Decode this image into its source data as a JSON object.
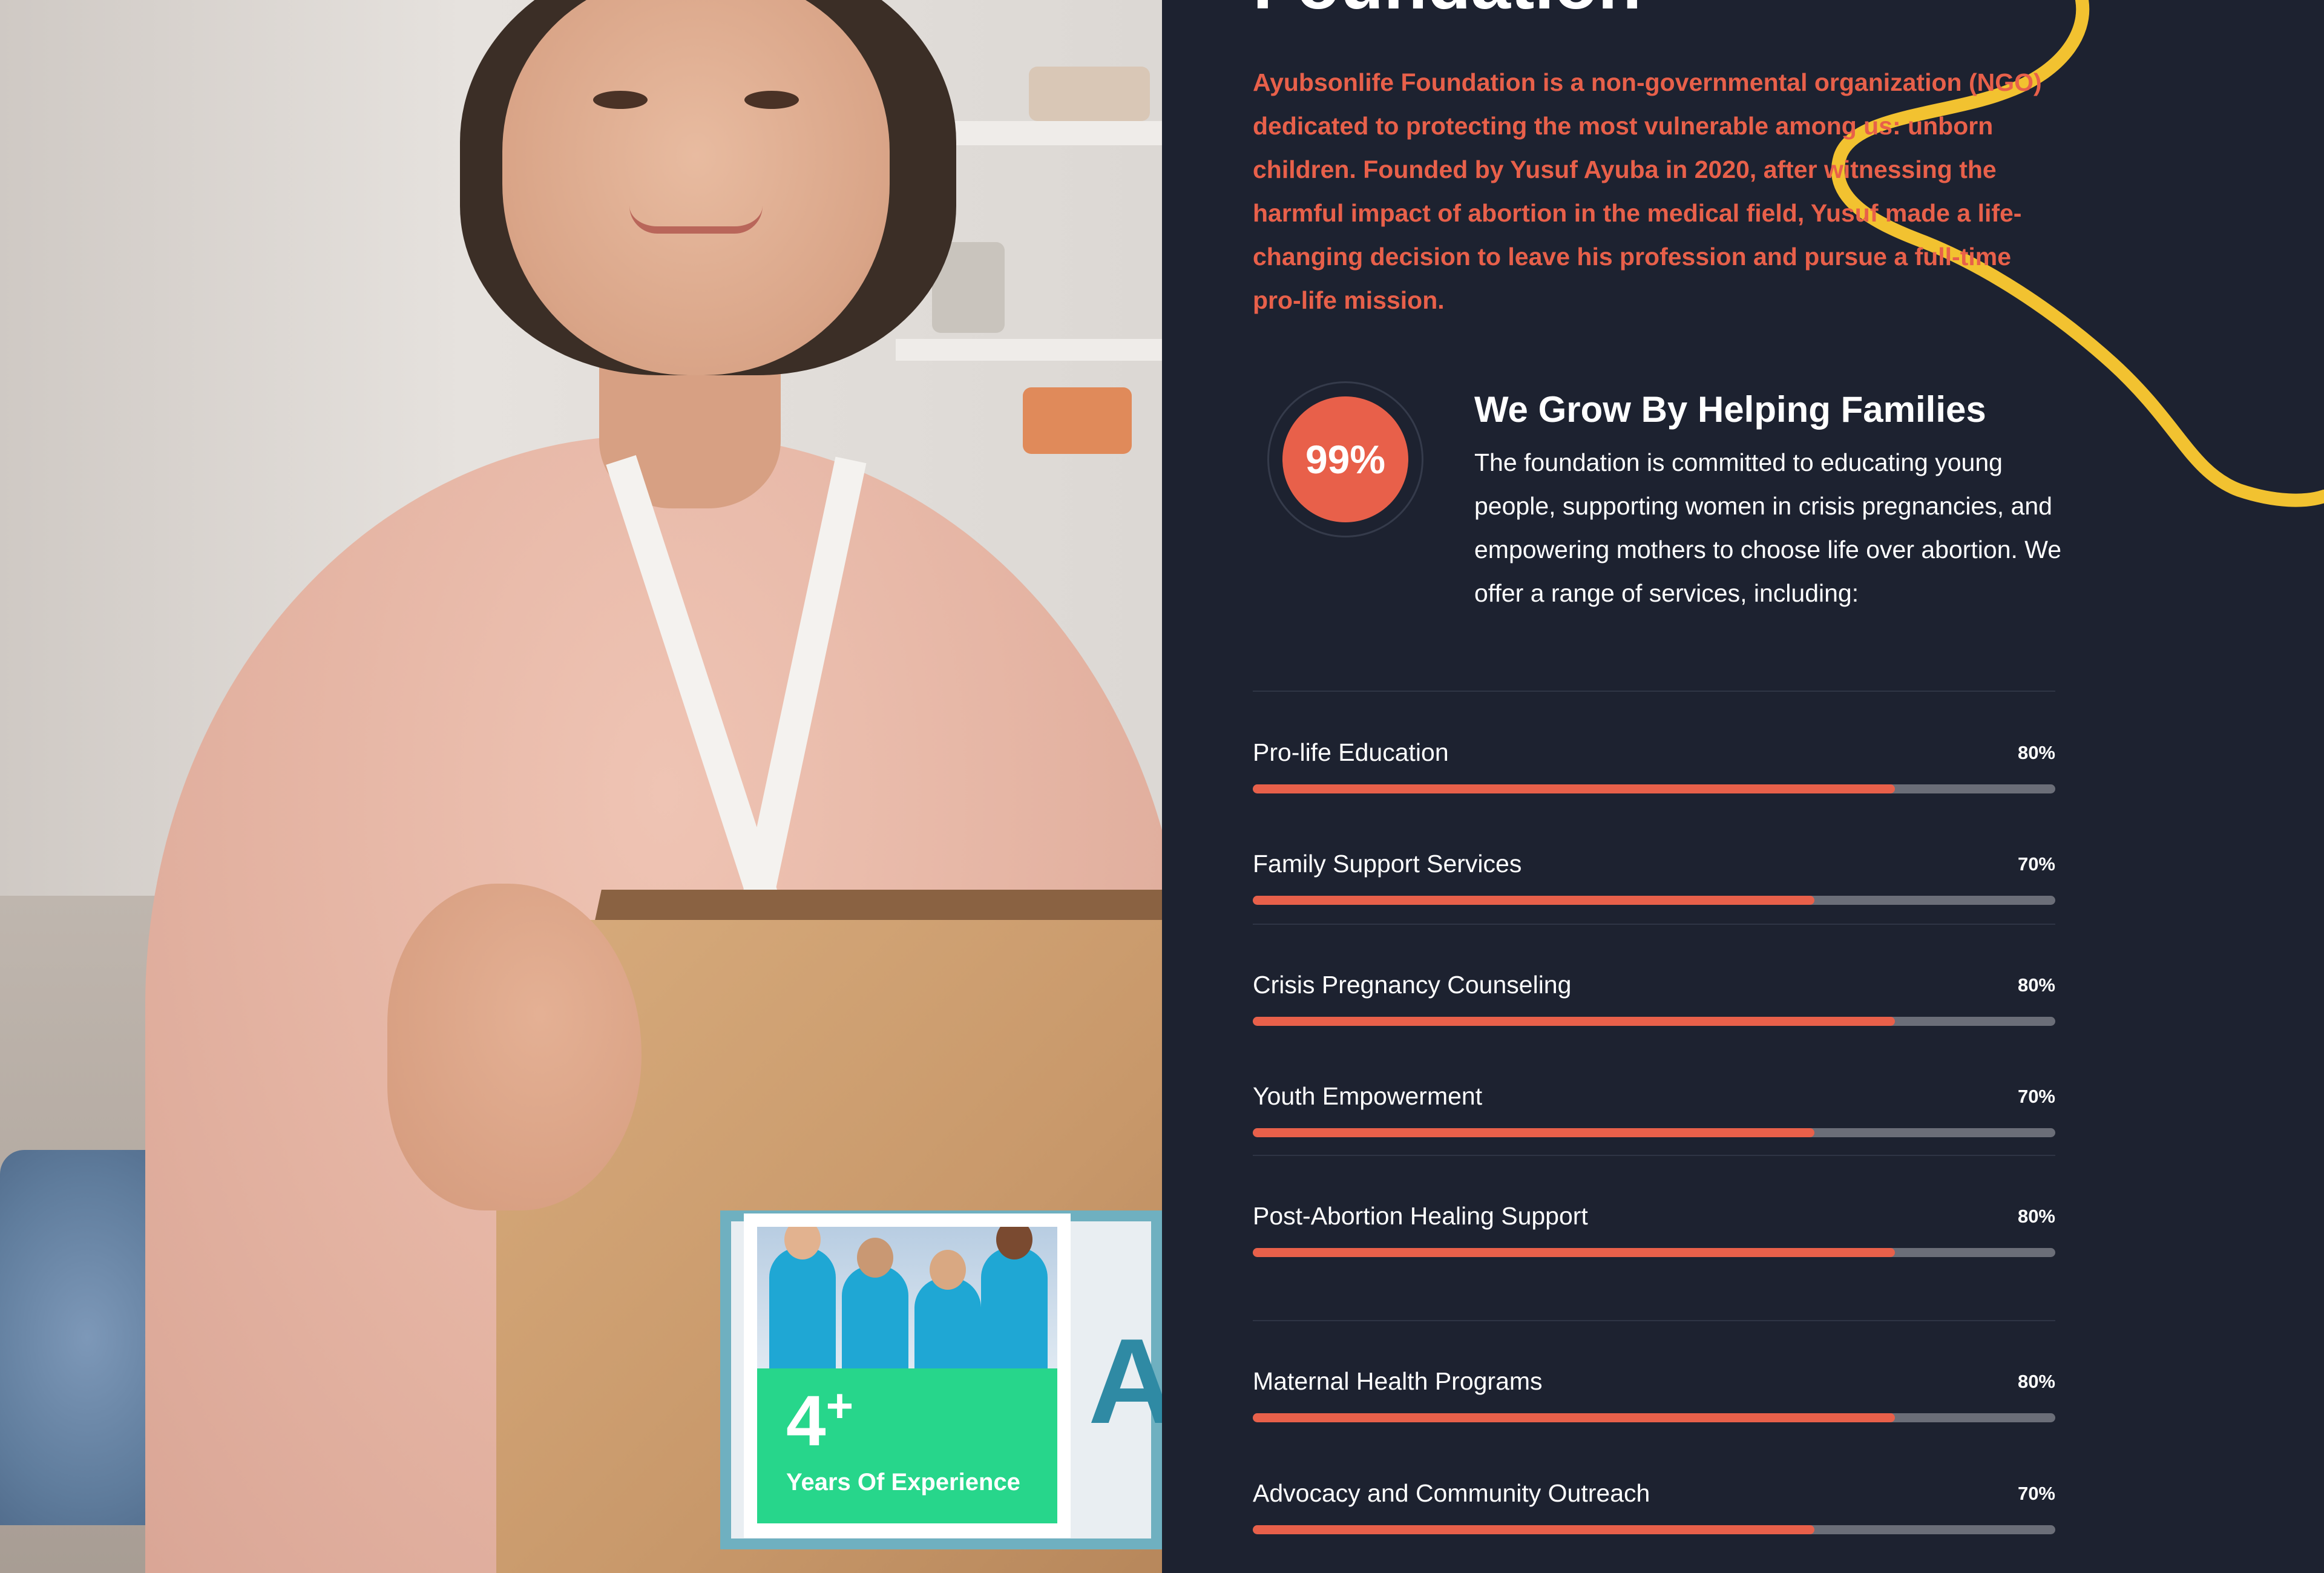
{
  "colors": {
    "accent": "#e8604a",
    "panel_bg": "#1d2230",
    "experience_green": "#27d68b",
    "squiggle_yellow": "#f2c230",
    "track_gray": "#6b6e78"
  },
  "photo": {
    "box_label_partial": "AT"
  },
  "experience_card": {
    "number": "4",
    "plus": "+",
    "label": "Years Of Experience"
  },
  "about": {
    "heading_partial": "Foundation",
    "intro": "Ayubsonlife Foundation is a non-governmental organization (NGO) dedicated to protecting the most vulnerable among us: unborn children. Founded by Yusuf Ayuba in 2020, after witnessing the harmful impact of abortion in the medical field, Yusuf made a life-changing decision to leave his profession and pursue a full-time pro-life mission.",
    "badge_value": "99%",
    "grow_title": "We Grow By Helping Families",
    "grow_text": "The foundation is committed to educating young people, supporting women in crisis pregnancies, and empowering mothers to choose life over abortion. We offer a range of services, including:"
  },
  "skills": [
    {
      "label": "Pro-life Education",
      "percent_label": "80%",
      "value": 0.8
    },
    {
      "label": "Family Support Services",
      "percent_label": "70%",
      "value": 0.7
    },
    {
      "label": "Crisis Pregnancy Counseling",
      "percent_label": "80%",
      "value": 0.8
    },
    {
      "label": "Youth Empowerment",
      "percent_label": "70%",
      "value": 0.7
    },
    {
      "label": "Post-Abortion Healing Support",
      "percent_label": "80%",
      "value": 0.8
    },
    {
      "label": "Maternal Health Programs",
      "percent_label": "80%",
      "value": 0.8
    },
    {
      "label": "Advocacy and Community Outreach",
      "percent_label": "70%",
      "value": 0.7
    }
  ]
}
